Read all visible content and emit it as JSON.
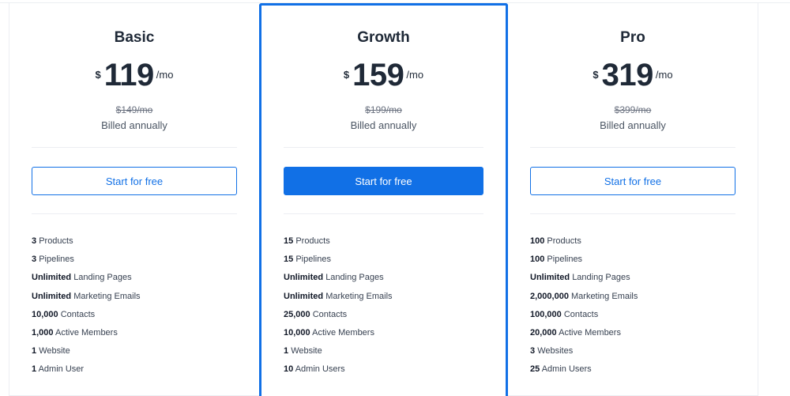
{
  "plans": [
    {
      "name": "Basic",
      "currency": "$",
      "amount": "119",
      "period": "/mo",
      "old_price": "$149/mo",
      "billing": "Billed annually",
      "cta_label": "Start for free",
      "features": [
        {
          "bold": "3",
          "text": "Products"
        },
        {
          "bold": "3",
          "text": "Pipelines"
        },
        {
          "bold": "Unlimited",
          "text": "Landing Pages"
        },
        {
          "bold": "Unlimited",
          "text": "Marketing Emails"
        },
        {
          "bold": "10,000",
          "text": "Contacts"
        },
        {
          "bold": "1,000",
          "text": "Active Members"
        },
        {
          "bold": "1",
          "text": "Website"
        },
        {
          "bold": "1",
          "text": "Admin User"
        }
      ]
    },
    {
      "name": "Growth",
      "currency": "$",
      "amount": "159",
      "period": "/mo",
      "old_price": "$199/mo",
      "billing": "Billed annually",
      "cta_label": "Start for free",
      "features": [
        {
          "bold": "15",
          "text": "Products"
        },
        {
          "bold": "15",
          "text": "Pipelines"
        },
        {
          "bold": "Unlimited",
          "text": "Landing Pages"
        },
        {
          "bold": "Unlimited",
          "text": "Marketing Emails"
        },
        {
          "bold": "25,000",
          "text": "Contacts"
        },
        {
          "bold": "10,000",
          "text": "Active Members"
        },
        {
          "bold": "1",
          "text": "Website"
        },
        {
          "bold": "10",
          "text": "Admin Users"
        }
      ]
    },
    {
      "name": "Pro",
      "currency": "$",
      "amount": "319",
      "period": "/mo",
      "old_price": "$399/mo",
      "billing": "Billed annually",
      "cta_label": "Start for free",
      "features": [
        {
          "bold": "100",
          "text": "Products"
        },
        {
          "bold": "100",
          "text": "Pipelines"
        },
        {
          "bold": "Unlimited",
          "text": "Landing Pages"
        },
        {
          "bold": "2,000,000",
          "text": "Marketing Emails"
        },
        {
          "bold": "100,000",
          "text": "Contacts"
        },
        {
          "bold": "20,000",
          "text": "Active Members"
        },
        {
          "bold": "3",
          "text": "Websites"
        },
        {
          "bold": "25",
          "text": "Admin Users"
        }
      ]
    }
  ],
  "colors": {
    "accent": "#1170e6",
    "text": "#1f2937",
    "muted": "#6b7280",
    "divider": "#eceef2"
  }
}
